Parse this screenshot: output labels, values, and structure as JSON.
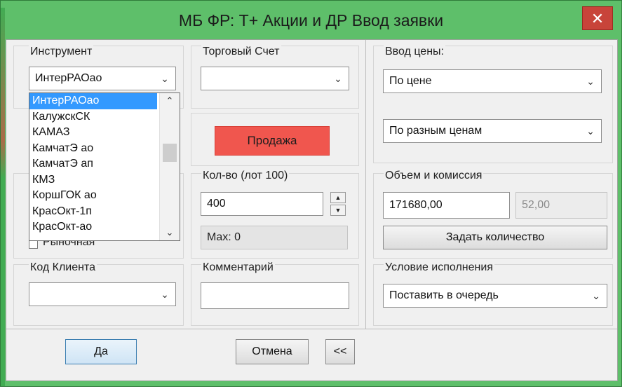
{
  "window": {
    "title": "МБ ФР: Т+ Акции и ДР Ввод заявки",
    "close_glyph": "✕"
  },
  "instrument": {
    "label": "Инструмент",
    "value": "ИнтерРАОао",
    "dropdown_items": [
      "ИнтерРАОао",
      "КалужскСК",
      "КАМАЗ",
      "КамчатЭ ао",
      "КамчатЭ ап",
      "КМЗ",
      "КоршГОК ао",
      "КрасОкт-1п",
      "КрасОкт-ао"
    ]
  },
  "account": {
    "label": "Торговый Счет",
    "value": ""
  },
  "price_entry": {
    "label": "Ввод цены:",
    "mode": "По цене",
    "multi": "По разным ценам"
  },
  "side_button": {
    "label": "Продажа",
    "color": "#f0564e"
  },
  "quantity": {
    "label": "Кол-во (лот 100)",
    "value": "400",
    "max_text": "Max: 0"
  },
  "volume": {
    "label": "Объем  и комиссия",
    "volume_value": "171680,00",
    "commission_value": "52,00",
    "set_quantity_label": "Задать количество"
  },
  "market_checkbox": {
    "label": "Рыночная"
  },
  "client_code": {
    "label": "Код Клиента",
    "value": ""
  },
  "comment": {
    "label": "Комментарий",
    "value": ""
  },
  "execution": {
    "label": "Условие исполнения",
    "value": "Поставить в очередь"
  },
  "footer": {
    "ok_label": "Да",
    "cancel_label": "Отмена",
    "collapse_label": "<<"
  },
  "icons": {
    "chevron": "chevron-down-icon",
    "close": "close-icon"
  }
}
